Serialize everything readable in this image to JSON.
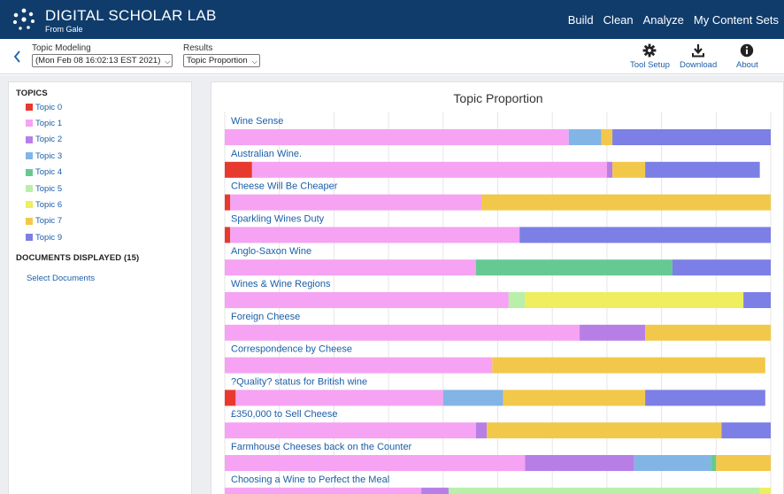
{
  "header": {
    "brand": "DIGITAL SCHOLAR LAB",
    "brand_sub": "From Gale",
    "logo_icon": "gale-logo-icon",
    "nav": [
      "Build",
      "Clean",
      "Analyze",
      "My Content Sets"
    ]
  },
  "toolbar": {
    "back_icon": "chevron-left-icon",
    "topic_modeling_label": "Topic Modeling",
    "run_value": "(Mon Feb 08 16:02:13 EST 2021)",
    "results_label": "Results",
    "results_value": "Topic Proportion",
    "tools": [
      {
        "label": "Tool Setup",
        "icon": "gear-icon"
      },
      {
        "label": "Download",
        "icon": "download-icon"
      },
      {
        "label": "About",
        "icon": "info-icon"
      }
    ]
  },
  "sidebar": {
    "topics_title": "TOPICS",
    "topics": [
      {
        "label": "Topic 0",
        "color": "#e8392f"
      },
      {
        "label": "Topic 1",
        "color": "#f5a3f2"
      },
      {
        "label": "Topic 2",
        "color": "#b77fe6"
      },
      {
        "label": "Topic 3",
        "color": "#83b4e6"
      },
      {
        "label": "Topic 4",
        "color": "#66c994"
      },
      {
        "label": "Topic 5",
        "color": "#b8f0aa"
      },
      {
        "label": "Topic 6",
        "color": "#eeee5e"
      },
      {
        "label": "Topic 7",
        "color": "#f2c84b"
      },
      {
        "label": "Topic 9",
        "color": "#7c7fe6"
      }
    ],
    "docs_title": "DOCUMENTS DISPLAYED (15)",
    "select_docs": "Select Documents"
  },
  "chart_data": {
    "type": "bar",
    "orientation": "horizontal",
    "stacked": true,
    "title": "Topic Proportion",
    "xlim": [
      0,
      1
    ],
    "grid": true,
    "series_names": [
      "Topic 0",
      "Topic 1",
      "Topic 2",
      "Topic 3",
      "Topic 4",
      "Topic 5",
      "Topic 6",
      "Topic 7",
      "Topic 9"
    ],
    "documents": [
      {
        "title": "Wine Sense",
        "segments": [
          {
            "topic": "Topic 1",
            "value": 0.63
          },
          {
            "topic": "Topic 3",
            "value": 0.06
          },
          {
            "topic": "Topic 7",
            "value": 0.02
          },
          {
            "topic": "Topic 9",
            "value": 0.29
          }
        ]
      },
      {
        "title": "Australian Wine.",
        "segments": [
          {
            "topic": "Topic 0",
            "value": 0.05
          },
          {
            "topic": "Topic 1",
            "value": 0.65
          },
          {
            "topic": "Topic 2",
            "value": 0.01
          },
          {
            "topic": "Topic 7",
            "value": 0.06
          },
          {
            "topic": "Topic 9",
            "value": 0.21
          }
        ]
      },
      {
        "title": "Cheese Will Be Cheaper",
        "segments": [
          {
            "topic": "Topic 0",
            "value": 0.01
          },
          {
            "topic": "Topic 1",
            "value": 0.46
          },
          {
            "topic": "Topic 7",
            "value": 0.53
          }
        ]
      },
      {
        "title": "Sparkling Wines Duty",
        "segments": [
          {
            "topic": "Topic 0",
            "value": 0.01
          },
          {
            "topic": "Topic 1",
            "value": 0.53
          },
          {
            "topic": "Topic 9",
            "value": 0.46
          }
        ]
      },
      {
        "title": "Anglo-Saxon Wine",
        "segments": [
          {
            "topic": "Topic 1",
            "value": 0.46
          },
          {
            "topic": "Topic 4",
            "value": 0.36
          },
          {
            "topic": "Topic 9",
            "value": 0.18
          }
        ]
      },
      {
        "title": "Wines & Wine Regions",
        "segments": [
          {
            "topic": "Topic 1",
            "value": 0.52
          },
          {
            "topic": "Topic 5",
            "value": 0.03
          },
          {
            "topic": "Topic 6",
            "value": 0.4
          },
          {
            "topic": "Topic 9",
            "value": 0.05
          }
        ]
      },
      {
        "title": "Foreign Cheese",
        "segments": [
          {
            "topic": "Topic 1",
            "value": 0.65
          },
          {
            "topic": "Topic 2",
            "value": 0.12
          },
          {
            "topic": "Topic 7",
            "value": 0.23
          }
        ]
      },
      {
        "title": "Correspondence by Cheese",
        "segments": [
          {
            "topic": "Topic 1",
            "value": 0.49
          },
          {
            "topic": "Topic 7",
            "value": 0.5
          }
        ]
      },
      {
        "title": "?Quality? status for British wine",
        "segments": [
          {
            "topic": "Topic 0",
            "value": 0.02
          },
          {
            "topic": "Topic 1",
            "value": 0.38
          },
          {
            "topic": "Topic 3",
            "value": 0.11
          },
          {
            "topic": "Topic 7",
            "value": 0.26
          },
          {
            "topic": "Topic 9",
            "value": 0.22
          }
        ]
      },
      {
        "title": "£350,000 to Sell Cheese",
        "segments": [
          {
            "topic": "Topic 1",
            "value": 0.46
          },
          {
            "topic": "Topic 2",
            "value": 0.02
          },
          {
            "topic": "Topic 7",
            "value": 0.43
          },
          {
            "topic": "Topic 9",
            "value": 0.09
          }
        ]
      },
      {
        "title": "Farmhouse Cheeses back on the Counter",
        "segments": [
          {
            "topic": "Topic 1",
            "value": 0.55
          },
          {
            "topic": "Topic 2",
            "value": 0.2
          },
          {
            "topic": "Topic 3",
            "value": 0.14
          },
          {
            "topic": "Topic 4",
            "value": 0.01
          },
          {
            "topic": "Topic 7",
            "value": 0.1
          }
        ]
      },
      {
        "title": "Choosing a Wine to Perfect the Meal",
        "segments": [
          {
            "topic": "Topic 1",
            "value": 0.36
          },
          {
            "topic": "Topic 2",
            "value": 0.05
          },
          {
            "topic": "Topic 5",
            "value": 0.57
          },
          {
            "topic": "Topic 6",
            "value": 0.02
          }
        ]
      }
    ]
  }
}
